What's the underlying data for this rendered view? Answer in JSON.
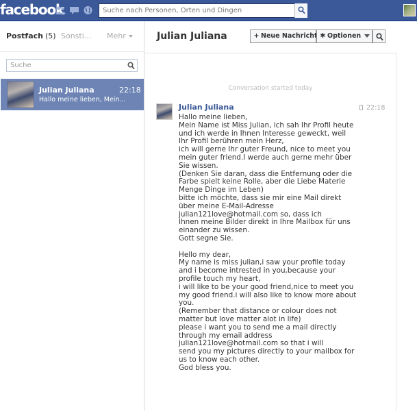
{
  "topbar": {
    "logo": "facebook",
    "search_placeholder": "Suche nach Personen, Orten und Dingen"
  },
  "sidebar": {
    "inbox_label": "Postfach",
    "inbox_count": "(5)",
    "other_label": "Sonsti...",
    "more_label": "Mehr",
    "filter_placeholder": "Suche",
    "threads": [
      {
        "name": "Julian Juliana",
        "time": "22:18",
        "snippet": "Hallo meine lieben, Mein..."
      }
    ]
  },
  "conversation": {
    "title": "Julian Juliana",
    "new_message_label": "Neue Nachricht",
    "options_label": "Optionen",
    "started_text": "Conversation started today",
    "message": {
      "sender": "Julian Juliana",
      "time": "22:18",
      "body": "Hallo meine lieben,\nMein Name ist Miss Julian, ich sah Ihr Profil heute\nund ich werde in Ihnen Interesse geweckt, weil\nIhr Profil berühren mein Herz,\nich will gerne Ihr guter Freund, nice to meet you\nmein guter friend.I werde auch gerne mehr über\nSie wissen.\n(Denken Sie daran, dass die Entfernung oder die\nFarbe spielt keine Rolle, aber die Liebe Materie\nMenge Dinge im Leben)\nbitte ich möchte, dass sie mir eine Mail direkt\nüber meine E-Mail-Adresse\njulian121love@hotmail.com so, dass ich\nIhnen meine Bilder direkt in Ihre Mailbox für uns\neinander zu wissen.\nGott segne Sie.\n\nHello my dear,\nMy name is miss julian,i saw your profile today\nand i become intrested in you,because your\nprofile touch my heart,\ni will like to be your good friend,nice to meet you\nmy good friend.i will also like to know more about\nyou.\n(Remember that distance or colour does not\nmatter but love matter alot in life)\nplease i want you to send me a mail directly\nthrough my email address\njulian121love@hotmail.com so that i will\nsend you my pictures directly to your mailbox for\nus to know each other.\nGod bless you."
    }
  },
  "colors": {
    "brand_blue": "#3b5998",
    "selected_thread": "#6d84b4"
  }
}
